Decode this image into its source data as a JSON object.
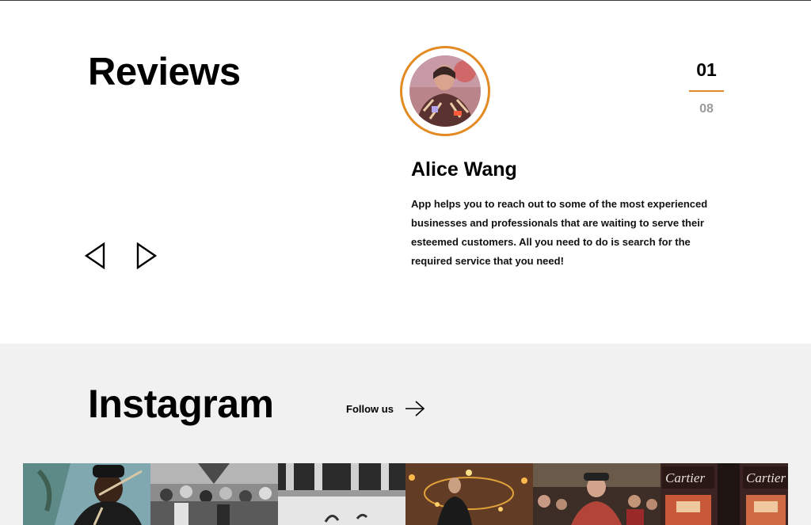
{
  "reviews": {
    "title": "Reviews",
    "prev_icon": "triangle-left-icon",
    "next_icon": "triangle-right-icon",
    "counter_current": "01",
    "counter_total": "08",
    "reviewer_name": "Alice Wang",
    "review_text": "App helps you to reach out to some of the most experienced businesses and professionals that are waiting to serve their esteemed customers. All you need to do is  search for the required service that you need!"
  },
  "instagram": {
    "title": "Instagram",
    "follow_label": "Follow us",
    "follow_icon": "arrow-right-icon",
    "photo_sign_text": "Cartier"
  },
  "colors": {
    "accent": "#e38a23",
    "muted": "#9b9b9b",
    "section_bg": "#f1f1f1"
  }
}
